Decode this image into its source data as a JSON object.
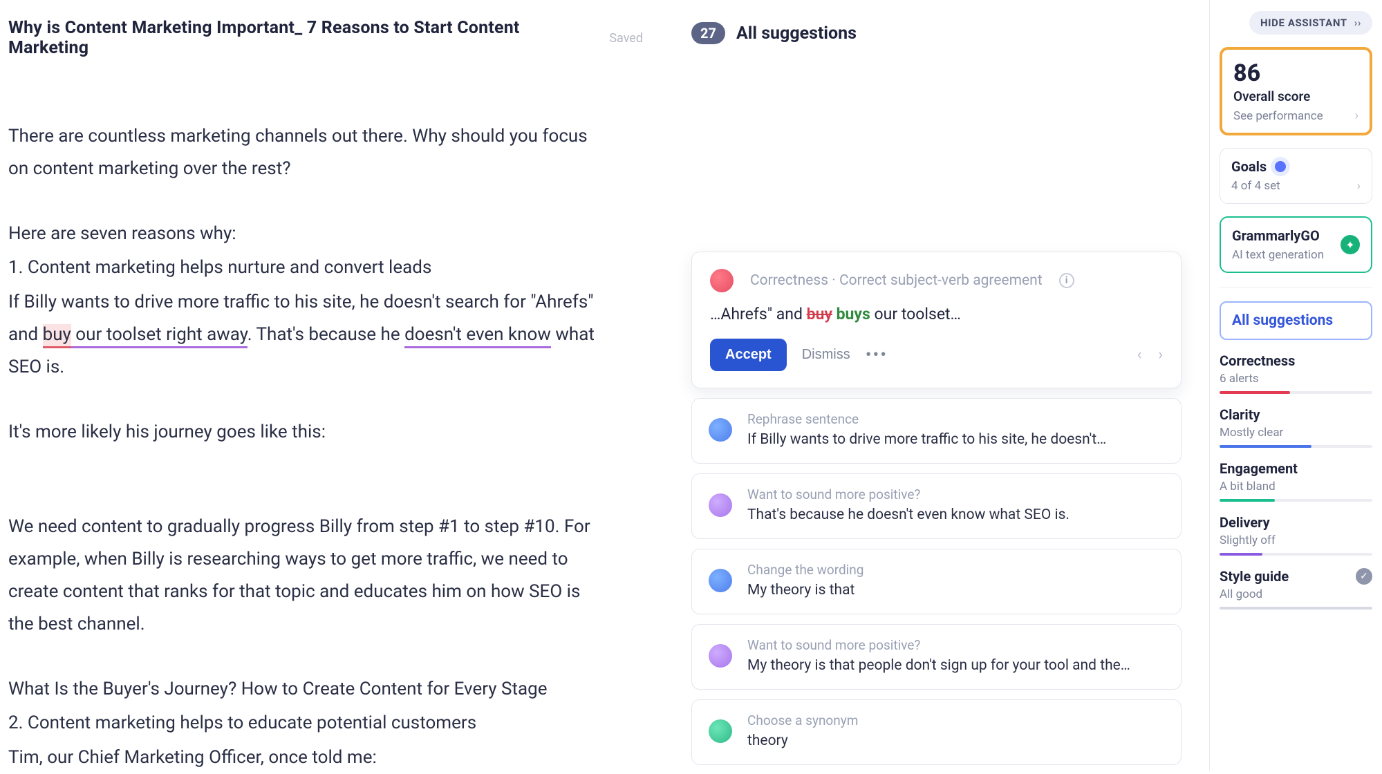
{
  "document": {
    "title": "Why is Content Marketing Important_ 7 Reasons to Start Content Marketing",
    "save_state": "Saved",
    "paragraphs": {
      "intro": "There are countless marketing channels out there. Why should you focus on content marketing over the rest?",
      "lead": "Here are seven reasons why:",
      "h1": "1. Content marketing helps nurture and convert leads",
      "p1a": "If Billy wants to drive more traffic to his site, he doesn't search for \"Ahrefs\" and ",
      "buy": "buy",
      "p1b": " our toolset right away",
      "p1c": ". That's because he ",
      "p1d": "doesn't even know",
      "p1e": " what SEO is.",
      "p2": "It's more likely his journey goes like this:",
      "p3": "We need content to gradually progress Billy from step #1 to step #10. For example, when Billy is researching ways to get more traffic, we need to create content that ranks for that topic and educates him on how SEO is the best channel.",
      "p4": "What Is the Buyer's Journey? How to Create Content for Every Stage",
      "h2": "2. Content marketing helps to educate potential customers",
      "p5": "Tim, our Chief Marketing Officer, once told me:"
    }
  },
  "suggestions": {
    "count": "27",
    "header": "All suggestions",
    "expanded": {
      "category": "Correctness · Correct subject-verb agreement",
      "prefix": "…Ahrefs\" and ",
      "strike": "buy",
      "insert": "buys",
      "suffix": " our toolset…",
      "accept": "Accept",
      "dismiss": "Dismiss"
    },
    "list": [
      {
        "icon": "blue",
        "category": "Rephrase sentence",
        "snippet": "If Billy wants to drive more traffic to his site, he doesn't…"
      },
      {
        "icon": "purple",
        "category": "Want to sound more positive?",
        "snippet": "That's because he doesn't even know what SEO is."
      },
      {
        "icon": "blue",
        "category": "Change the wording",
        "snippet": "My theory is that"
      },
      {
        "icon": "purple",
        "category": "Want to sound more positive?",
        "snippet": "My theory is that people don't sign up for your tool and the…"
      },
      {
        "icon": "green",
        "category": "Choose a synonym",
        "snippet": "theory"
      }
    ]
  },
  "rail": {
    "hide": "HIDE ASSISTANT",
    "score": {
      "value": "86",
      "label": "Overall score",
      "link": "See performance"
    },
    "goals": {
      "title": "Goals",
      "sub": "4 of 4 set"
    },
    "ggo": {
      "title": "GrammarlyGO",
      "sub": "AI text generation"
    },
    "tab": "All suggestions",
    "metrics": {
      "correctness": {
        "title": "Correctness",
        "sub": "6 alerts"
      },
      "clarity": {
        "title": "Clarity",
        "sub": "Mostly clear"
      },
      "engagement": {
        "title": "Engagement",
        "sub": "A bit bland"
      },
      "delivery": {
        "title": "Delivery",
        "sub": "Slightly off"
      },
      "style": {
        "title": "Style guide",
        "sub": "All good"
      }
    }
  }
}
